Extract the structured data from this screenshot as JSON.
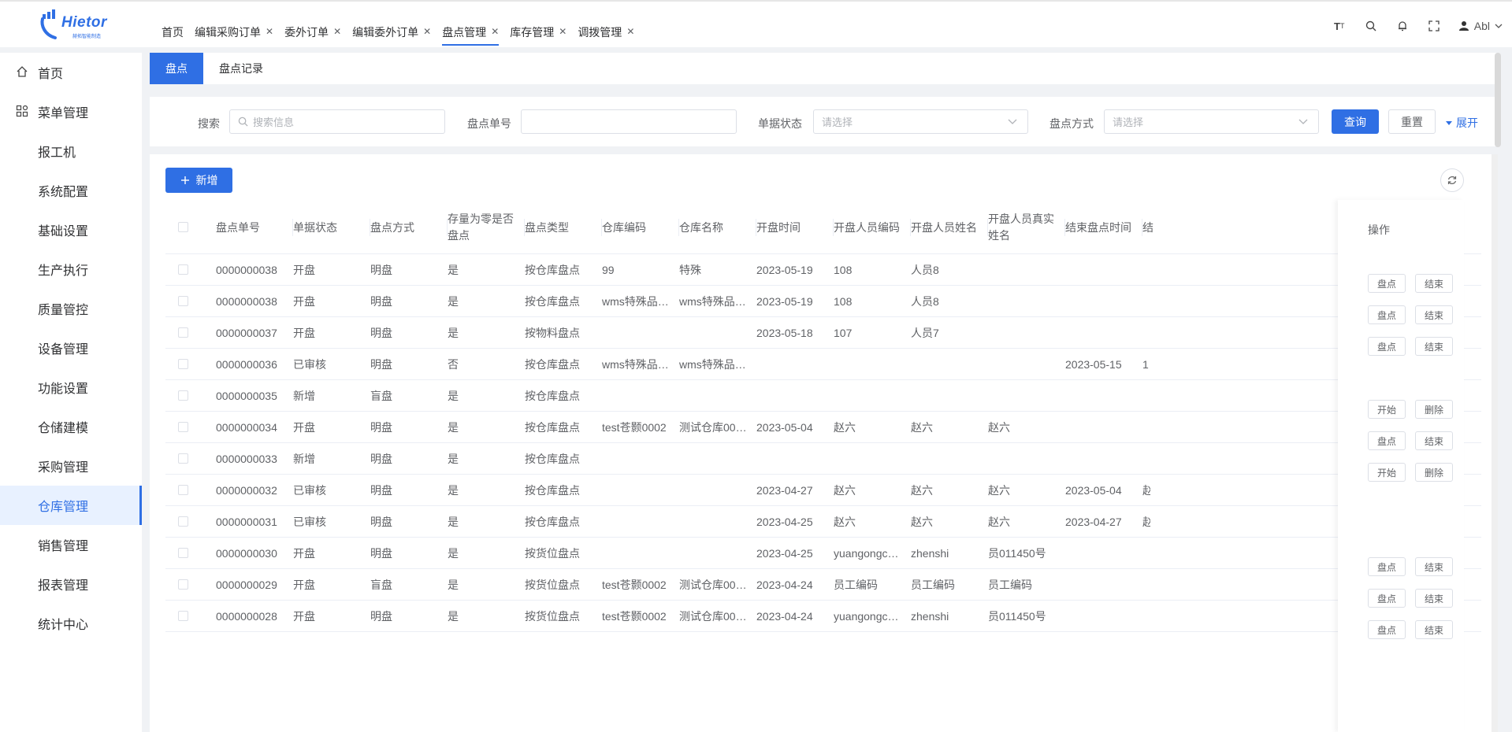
{
  "brand": {
    "name": "Hietor",
    "sub": "赫拓智能制造"
  },
  "header": {
    "tabs": [
      {
        "label": "首页",
        "closable": false
      },
      {
        "label": "编辑采购订单",
        "closable": true
      },
      {
        "label": "委外订单",
        "closable": true
      },
      {
        "label": "编辑委外订单",
        "closable": true
      },
      {
        "label": "盘点管理",
        "closable": true,
        "active": true
      },
      {
        "label": "库存管理",
        "closable": true
      },
      {
        "label": "调拨管理",
        "closable": true
      }
    ],
    "user": "Abl",
    "font_icon_text": "T"
  },
  "sidebar": {
    "items": [
      {
        "label": "首页",
        "icon": "home-icon"
      },
      {
        "label": "菜单管理",
        "icon": "grid-icon"
      },
      {
        "label": "报工机"
      },
      {
        "label": "系统配置"
      },
      {
        "label": "基础设置"
      },
      {
        "label": "生产执行"
      },
      {
        "label": "质量管控"
      },
      {
        "label": "设备管理"
      },
      {
        "label": "功能设置"
      },
      {
        "label": "仓储建模"
      },
      {
        "label": "采购管理"
      },
      {
        "label": "仓库管理",
        "active": true
      },
      {
        "label": "销售管理"
      },
      {
        "label": "报表管理"
      },
      {
        "label": "统计中心"
      }
    ]
  },
  "subtabs": [
    "盘点",
    "盘点记录"
  ],
  "filter": {
    "search_label": "搜索",
    "search_placeholder": "搜索信息",
    "code_label": "盘点单号",
    "status_label": "单据状态",
    "status_placeholder": "请选择",
    "method_label": "盘点方式",
    "method_placeholder": "请选择",
    "query": "查询",
    "reset": "重置",
    "expand": "展开"
  },
  "toolbar": {
    "add": "新增"
  },
  "table": {
    "columns": [
      "盘点单号",
      "单据状态",
      "盘点方式",
      "存量为零是否盘点",
      "盘点类型",
      "仓库编码",
      "仓库名称",
      "开盘时间",
      "开盘人员编码",
      "开盘人员姓名",
      "开盘人员真实姓名",
      "结束盘点时间",
      "结"
    ],
    "op_header": "操作",
    "rows": [
      {
        "c": [
          "0000000038",
          "开盘",
          "明盘",
          "是",
          "按仓库盘点",
          "99",
          "特殊",
          "2023-05-19",
          "108",
          "人员8",
          "",
          "",
          ""
        ],
        "ops": [
          "盘点",
          "结束"
        ]
      },
      {
        "c": [
          "0000000038",
          "开盘",
          "明盘",
          "是",
          "按仓库盘点",
          "wms特殊品…",
          "wms特殊品…",
          "2023-05-19",
          "108",
          "人员8",
          "",
          "",
          ""
        ],
        "ops": [
          "盘点",
          "结束"
        ]
      },
      {
        "c": [
          "0000000037",
          "开盘",
          "明盘",
          "是",
          "按物料盘点",
          "",
          "",
          "2023-05-18",
          "107",
          "人员7",
          "",
          "",
          ""
        ],
        "ops": [
          "盘点",
          "结束"
        ]
      },
      {
        "c": [
          "0000000036",
          "已审核",
          "明盘",
          "否",
          "按仓库盘点",
          "wms特殊品…",
          "wms特殊品…",
          "",
          "",
          "",
          "",
          "2023-05-15",
          "1"
        ],
        "ops": []
      },
      {
        "c": [
          "0000000035",
          "新增",
          "盲盘",
          "是",
          "按仓库盘点",
          "",
          "",
          "",
          "",
          "",
          "",
          "",
          ""
        ],
        "ops": [
          "开始",
          "删除"
        ]
      },
      {
        "c": [
          "0000000034",
          "开盘",
          "明盘",
          "是",
          "按仓库盘点",
          "test苍颢0002",
          "测试仓库00…",
          "2023-05-04",
          "赵六",
          "赵六",
          "赵六",
          "",
          ""
        ],
        "ops": [
          "盘点",
          "结束"
        ]
      },
      {
        "c": [
          "0000000033",
          "新增",
          "明盘",
          "是",
          "按仓库盘点",
          "",
          "",
          "",
          "",
          "",
          "",
          "",
          ""
        ],
        "ops": [
          "开始",
          "删除"
        ]
      },
      {
        "c": [
          "0000000032",
          "已审核",
          "明盘",
          "是",
          "按仓库盘点",
          "",
          "",
          "2023-04-27",
          "赵六",
          "赵六",
          "赵六",
          "2023-05-04",
          "赵"
        ],
        "ops": []
      },
      {
        "c": [
          "0000000031",
          "已审核",
          "明盘",
          "是",
          "按仓库盘点",
          "",
          "",
          "2023-04-25",
          "赵六",
          "赵六",
          "赵六",
          "2023-04-27",
          "赵"
        ],
        "ops": []
      },
      {
        "c": [
          "0000000030",
          "开盘",
          "明盘",
          "是",
          "按货位盘点",
          "",
          "",
          "2023-04-25",
          "yuangongc…",
          "zhenshi",
          "员011450号",
          "",
          ""
        ],
        "ops": [
          "盘点",
          "结束"
        ]
      },
      {
        "c": [
          "0000000029",
          "开盘",
          "盲盘",
          "是",
          "按货位盘点",
          "test苍颢0002",
          "测试仓库00…",
          "2023-04-24",
          "员工编码",
          "员工编码",
          "员工编码",
          "",
          ""
        ],
        "ops": [
          "盘点",
          "结束"
        ]
      },
      {
        "c": [
          "0000000028",
          "开盘",
          "明盘",
          "是",
          "按货位盘点",
          "test苍颢0002",
          "测试仓库00…",
          "2023-04-24",
          "yuangongc…",
          "zhenshi",
          "员011450号",
          "",
          ""
        ],
        "ops": [
          "盘点",
          "结束"
        ]
      }
    ]
  },
  "colors": {
    "accent": "#2f6fe4"
  }
}
